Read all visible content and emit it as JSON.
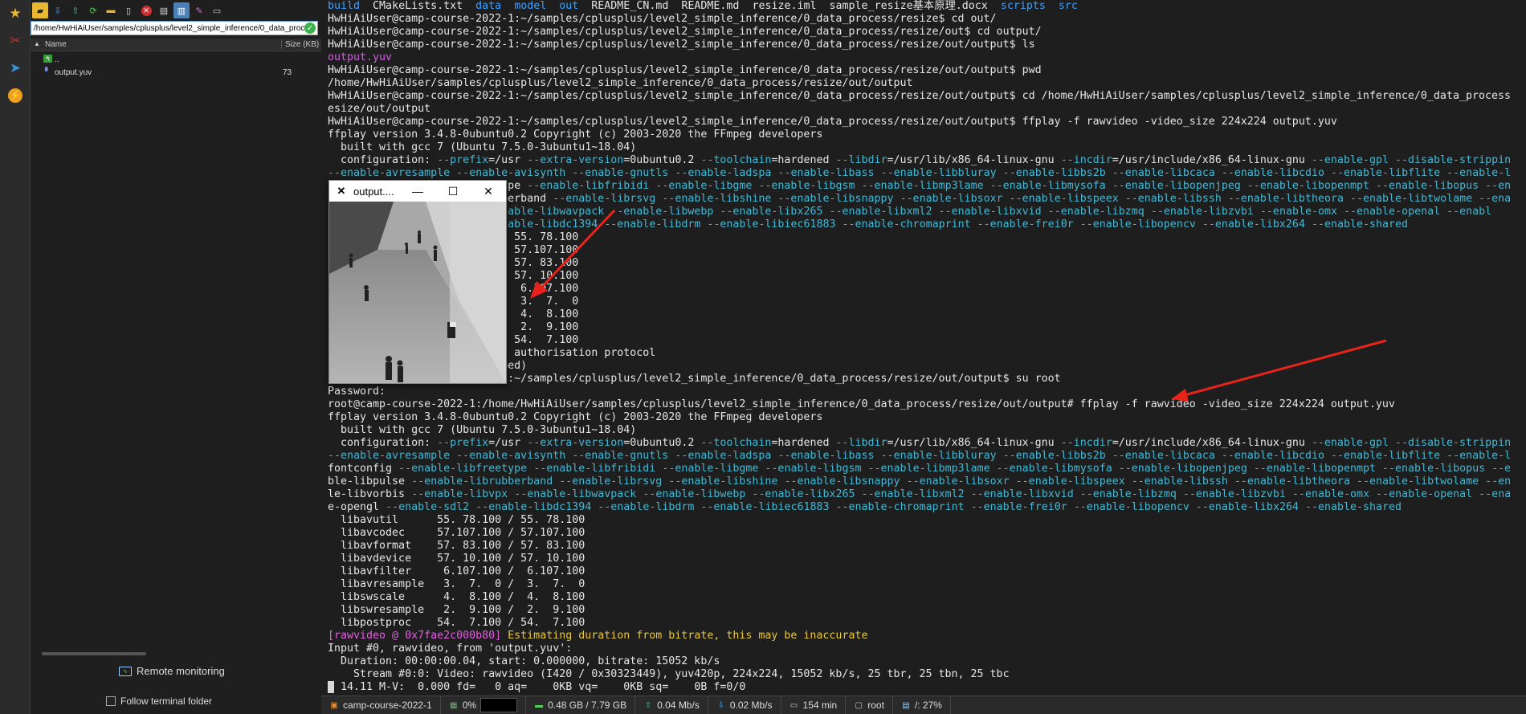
{
  "sftp": {
    "path": "/home/HwHiAiUser/samples/cplusplus/level2_simple_inference/0_data_process/resize/out/output",
    "columns": {
      "name": "Name",
      "size": "Size (KB)"
    },
    "files": [
      {
        "name": "..",
        "size": ""
      },
      {
        "name": "output.yuv",
        "size": "73"
      }
    ],
    "remote_monitoring": "Remote monitoring",
    "follow_terminal": "Follow terminal folder"
  },
  "ffplay_window": {
    "title": "output...."
  },
  "terminal": {
    "ls_line": [
      "build",
      "CMakeLists.txt",
      "data",
      "model",
      "out",
      "README_CN.md",
      "README.md",
      "resize.iml",
      "sample_resize基本原理.docx",
      "scripts",
      "src"
    ],
    "lines_a": [
      "HwHiAiUser@camp-course-2022-1:~/samples/cplusplus/level2_simple_inference/0_data_process/resize$ cd out/",
      "HwHiAiUser@camp-course-2022-1:~/samples/cplusplus/level2_simple_inference/0_data_process/resize/out$ cd output/",
      "HwHiAiUser@camp-course-2022-1:~/samples/cplusplus/level2_simple_inference/0_data_process/resize/out/output$ ls"
    ],
    "ls_output": "output.yuv",
    "lines_b": [
      "HwHiAiUser@camp-course-2022-1:~/samples/cplusplus/level2_simple_inference/0_data_process/resize/out/output$ pwd",
      "/home/HwHiAiUser/samples/cplusplus/level2_simple_inference/0_data_process/resize/out/output",
      "HwHiAiUser@camp-course-2022-1:~/samples/cplusplus/level2_simple_inference/0_data_process/resize/out/output$ cd /home/HwHiAiUser/samples/cplusplus/level2_simple_inference/0_data_process/r",
      "esize/out/output",
      "HwHiAiUser@camp-course-2022-1:~/samples/cplusplus/level2_simple_inference/0_data_process/resize/out/output$ ffplay -f rawvideo -video_size 224x224 output.yuv",
      "ffplay version 3.4.8-0ubuntu0.2 Copyright (c) 2003-2020 the FFmpeg developers",
      "  built with gcc 7 (Ubuntu 7.5.0-3ubuntu1~18.04)"
    ],
    "config_a": [
      "  configuration: --prefix=/usr --extra-version=0ubuntu0.2 --toolchain=hardened --libdir=/usr/lib/x86_64-linux-gnu --incdir=/usr/include/x86_64-linux-gnu --enable-gpl --disable-stripping",
      "--enable-avresample --enable-avisynth --enable-gnutls --enable-ladspa --enable-libass --enable-libbluray --enable-libbs2b --enable-libcaca --enable-libcdio --enable-libflite --enable-lib",
      "                           ype --enable-libfribidi --enable-libgme --enable-libgsm --enable-libmp3lame --enable-libmysofa --enable-libopenjpeg --enable-libopenmpt --enable-libopus --ena",
      "                           berband --enable-librsvg --enable-libshine --enable-libsnappy --enable-libsoxr --enable-libspeex --enable-libssh --enable-libtheora --enable-libtwolame --enab",
      "                        --enable-libwavpack --enable-libwebp --enable-libx265 --enable-libxml2 --enable-libxvid --enable-libzmq --enable-libzvbi --enable-omx --enable-openal --enabl",
      "                        --enable-libdc1394 --enable-libdrm --enable-libiec61883 --enable-chromaprint --enable-frei0r --enable-libopencv --enable-libx264 --enable-shared"
    ],
    "partial_b": [
      "                           / 55. 78.100",
      "                           / 57.107.100",
      "                           / 57. 83.100",
      "                           / 57. 10.100",
      "                           /  6.107.100",
      "                           /  3.  7.  0",
      "                           /  4.  8.100",
      "                           /  2.  9.100",
      "                           / 54.  7.100",
      "                           ( authorisation protocol",
      "                           bed)",
      "                           1:~/samples/cplusplus/level2_simple_inference/0_data_process/resize/out/output$ su root",
      "Password:",
      "root@camp-course-2022-1:/home/HwHiAiUser/samples/cplusplus/level2_simple_inference/0_data_process/resize/out/output# ffplay -f rawvideo -video_size 224x224 output.yuv",
      "ffplay version 3.4.8-0ubuntu0.2 Copyright (c) 2003-2020 the FFmpeg developers",
      "  built with gcc 7 (Ubuntu 7.5.0-3ubuntu1~18.04)"
    ],
    "config_b": [
      "  configuration: --prefix=/usr --extra-version=0ubuntu0.2 --toolchain=hardened --libdir=/usr/lib/x86_64-linux-gnu --incdir=/usr/include/x86_64-linux-gnu --enable-gpl --disable-stripping",
      "--enable-avresample --enable-avisynth --enable-gnutls --enable-ladspa --enable-libass --enable-libbluray --enable-libbs2b --enable-libcaca --enable-libcdio --enable-libflite --enable-lib",
      "fontconfig --enable-libfreetype --enable-libfribidi --enable-libgme --enable-libgsm --enable-libmp3lame --enable-libmysofa --enable-libopenjpeg --enable-libopenmpt --enable-libopus --ena",
      "ble-libpulse --enable-librubberband --enable-librsvg --enable-libshine --enable-libsnappy --enable-libsoxr --enable-libspeex --enable-libssh --enable-libtheora --enable-libtwolame --enab",
      "le-libvorbis --enable-libvpx --enable-libwavpack --enable-libwebp --enable-libx265 --enable-libxml2 --enable-libxvid --enable-libzmq --enable-libzvbi --enable-omx --enable-openal --enabl",
      "e-opengl --enable-sdl2 --enable-libdc1394 --enable-libdrm --enable-libiec61883 --enable-chromaprint --enable-frei0r --enable-libopencv --enable-libx264 --enable-shared"
    ],
    "libs": [
      "  libavutil      55. 78.100 / 55. 78.100",
      "  libavcodec     57.107.100 / 57.107.100",
      "  libavformat    57. 83.100 / 57. 83.100",
      "  libavdevice    57. 10.100 / 57. 10.100",
      "  libavfilter     6.107.100 /  6.107.100",
      "  libavresample   3.  7.  0 /  3.  7.  0",
      "  libswscale      4.  8.100 /  4.  8.100",
      "  libswresample   2.  9.100 /  2.  9.100",
      "  libpostproc    54.  7.100 / 54.  7.100"
    ],
    "rawvideo_tag": "[rawvideo @ 0x7fae2c000b80]",
    "rawvideo_msg": " Estimating duration from bitrate, this may be inaccurate",
    "tail": [
      "Input #0, rawvideo, from 'output.yuv':",
      "  Duration: 00:00:00.04, start: 0.000000, bitrate: 15052 kb/s",
      "    Stream #0:0: Video: rawvideo (I420 / 0x30323449), yuv420p, 224x224, 15052 kb/s, 25 tbr, 25 tbn, 25 tbc"
    ],
    "last_line": " 14.11 M-V:  0.000 fd=   0 aq=    0KB vq=    0KB sq=    0B f=0/0"
  },
  "status": {
    "host": "camp-course-2022-1",
    "cpu": "0%",
    "mem": "0.48 GB / 7.79 GB",
    "up": "0.04 Mb/s",
    "down": "0.02 Mb/s",
    "uptime": "154 min",
    "user": "root",
    "disk": "/: 27%"
  },
  "colors": {
    "annotation_arrow": "#e8231b",
    "dir": "#3aa0ff",
    "config": "#46b7d2"
  }
}
